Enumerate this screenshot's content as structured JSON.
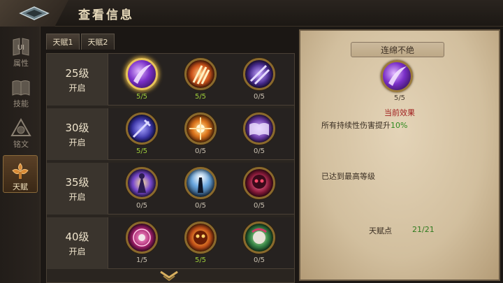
{
  "header": {
    "title": "查看信息"
  },
  "nav": [
    {
      "label": "属性",
      "icon": "attributes-icon",
      "active": false
    },
    {
      "label": "技能",
      "icon": "skill-book-icon",
      "active": false
    },
    {
      "label": "铭文",
      "icon": "inscription-icon",
      "active": false
    },
    {
      "label": "天赋",
      "icon": "talent-icon",
      "active": true
    }
  ],
  "tabs": [
    {
      "label": "天赋1",
      "active": true
    },
    {
      "label": "天赋2",
      "active": false
    }
  ],
  "rows": [
    {
      "level": "25级",
      "unlock": "开启",
      "talents": [
        {
          "icon": "purple-slash-icon",
          "count": "5/5",
          "full": true,
          "selected": true
        },
        {
          "icon": "fire-claw-icon",
          "count": "5/5",
          "full": true,
          "selected": false
        },
        {
          "icon": "shadow-blades-icon",
          "count": "0/5",
          "full": false,
          "selected": false
        }
      ]
    },
    {
      "level": "30级",
      "unlock": "开启",
      "talents": [
        {
          "icon": "arcane-sword-icon",
          "count": "5/5",
          "full": true,
          "selected": false
        },
        {
          "icon": "fire-burst-icon",
          "count": "0/5",
          "full": false,
          "selected": false
        },
        {
          "icon": "spellbook-icon",
          "count": "0/5",
          "full": false,
          "selected": false
        }
      ]
    },
    {
      "level": "35级",
      "unlock": "开启",
      "talents": [
        {
          "icon": "mage-silhouette-icon",
          "count": "0/5",
          "full": false,
          "selected": false
        },
        {
          "icon": "tower-light-icon",
          "count": "0/5",
          "full": false,
          "selected": false
        },
        {
          "icon": "demon-skull-icon",
          "count": "0/5",
          "full": false,
          "selected": false
        }
      ]
    },
    {
      "level": "40级",
      "unlock": "开启",
      "talents": [
        {
          "icon": "skull-sigil-icon",
          "count": "1/5",
          "full": false,
          "selected": false
        },
        {
          "icon": "flaming-skull-icon",
          "count": "5/5",
          "full": true,
          "selected": false
        },
        {
          "icon": "poison-skull-icon",
          "count": "0/5",
          "full": false,
          "selected": false
        }
      ]
    }
  ],
  "detail": {
    "name": "连绵不绝",
    "icon": "purple-slash-icon",
    "count": "5/5",
    "subtitle": "当前效果",
    "desc_prefix": "所有持续性伤害提升",
    "desc_value": "10%",
    "max_text": "已达到最高等级",
    "points_label": "天赋点",
    "points_value": "21/21"
  },
  "colors": {
    "full_count": "#9fcf3a",
    "subtitle": "#a01e1e",
    "highlight": "#2f8a1e"
  }
}
